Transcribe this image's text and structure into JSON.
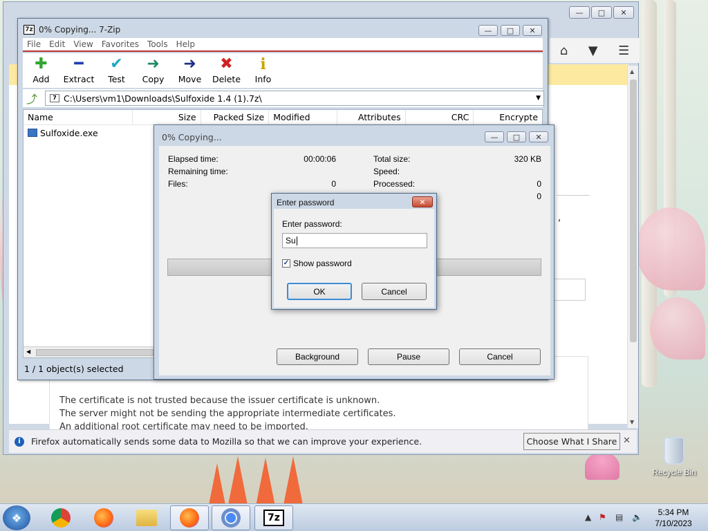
{
  "firefox": {
    "cert_lines": [
      "The certificate is not trusted because the issuer certificate is unknown.",
      "The server might not be sending the appropriate intermediate certificates.",
      "An additional root certificate may need to be imported."
    ],
    "notice_text": "Firefox automatically sends some data to Mozilla so that we can improve your experience.",
    "choose_label": "Choose What I Share",
    "comma": ","
  },
  "zip": {
    "title": "0% Copying... 7-Zip",
    "logo": "7z",
    "menu": [
      "File",
      "Edit",
      "View",
      "Favorites",
      "Tools",
      "Help"
    ],
    "toolbar": [
      {
        "label": "Add",
        "icon": "add-icon",
        "glyph": "✚",
        "color": "#2fa52f"
      },
      {
        "label": "Extract",
        "icon": "extract-icon",
        "glyph": "━",
        "color": "#1e3fb0"
      },
      {
        "label": "Test",
        "icon": "test-icon",
        "glyph": "✔",
        "color": "#1ba7c4"
      },
      {
        "label": "Copy",
        "icon": "copy-icon",
        "glyph": "➜",
        "color": "#1f8a6a"
      },
      {
        "label": "Move",
        "icon": "move-icon",
        "glyph": "➜",
        "color": "#1e3088"
      },
      {
        "label": "Delete",
        "icon": "delete-icon",
        "glyph": "✖",
        "color": "#d22020"
      },
      {
        "label": "Info",
        "icon": "info-icon",
        "glyph": "i",
        "color": "#c9a400"
      }
    ],
    "address": "C:\\Users\\vm1\\Downloads\\Sulfoxide 1.4 (1).7z\\",
    "columns": [
      "Name",
      "Size",
      "Packed Size",
      "Modified",
      "Attributes",
      "CRC",
      "Encrypte"
    ],
    "files": [
      {
        "name": "Sulfoxide.exe"
      }
    ],
    "status": "1 / 1 object(s) selected"
  },
  "copying": {
    "title": "0% Copying...",
    "elapsed_label": "Elapsed time:",
    "elapsed_value": "00:00:06",
    "remaining_label": "Remaining time:",
    "files_label": "Files:",
    "files_value": "0",
    "total_label": "Total size:",
    "total_value": "320 KB",
    "speed_label": "Speed:",
    "processed_label": "Processed:",
    "processed_value": "0",
    "extra_value": "0",
    "background_label": "Background",
    "pause_label": "Pause",
    "cancel_label": "Cancel"
  },
  "password": {
    "title": "Enter password",
    "prompt": "Enter password:",
    "value": "Su",
    "show_label": "Show password",
    "show_checked": true,
    "ok_label": "OK",
    "cancel_label": "Cancel"
  },
  "desktop": {
    "recycle_label": "Recycle Bin"
  },
  "taskbar": {
    "time": "5:34 PM",
    "date": "7/10/2023",
    "items": [
      "chrome-icon",
      "firefox-icon",
      "file-explorer-icon",
      "firefox-icon",
      "chrome-icon",
      "7zip-icon"
    ]
  }
}
